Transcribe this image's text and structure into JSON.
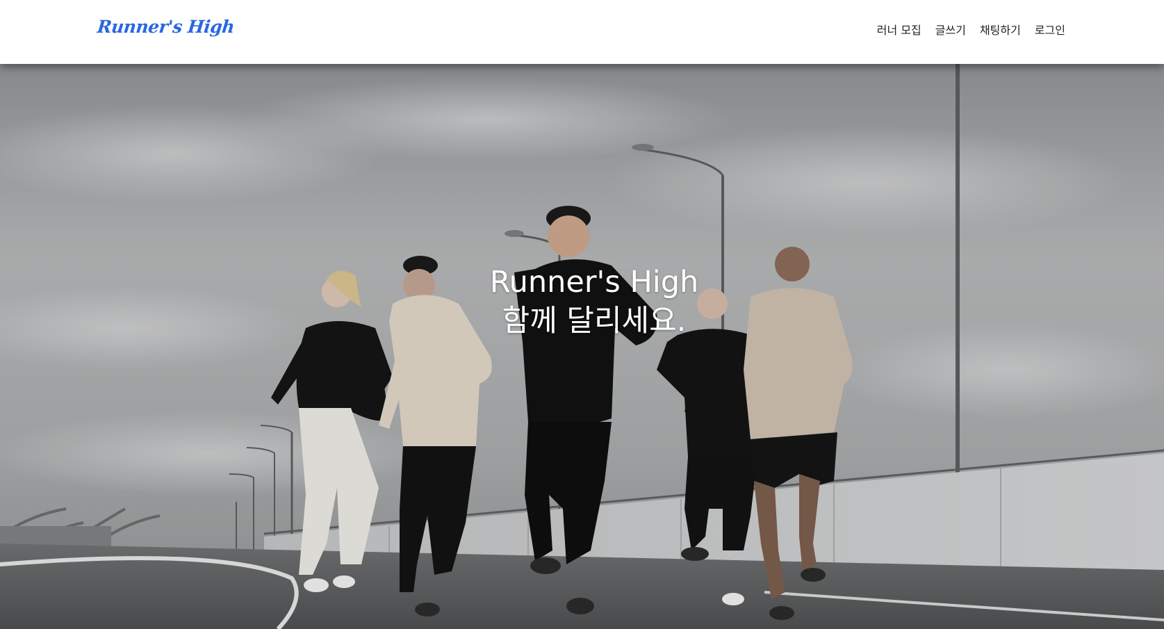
{
  "header": {
    "logo": "Runner's High",
    "nav": [
      {
        "label": "러너 모집"
      },
      {
        "label": "글쓰기"
      },
      {
        "label": "채팅하기"
      },
      {
        "label": "로그인"
      }
    ]
  },
  "hero": {
    "title": "Runner's High",
    "subtitle": "함께 달리세요."
  },
  "colors": {
    "logo": "#2a67e0",
    "navbar_bg": "#ffffff",
    "nav_text": "#222222",
    "hero_text": "#ffffff"
  }
}
